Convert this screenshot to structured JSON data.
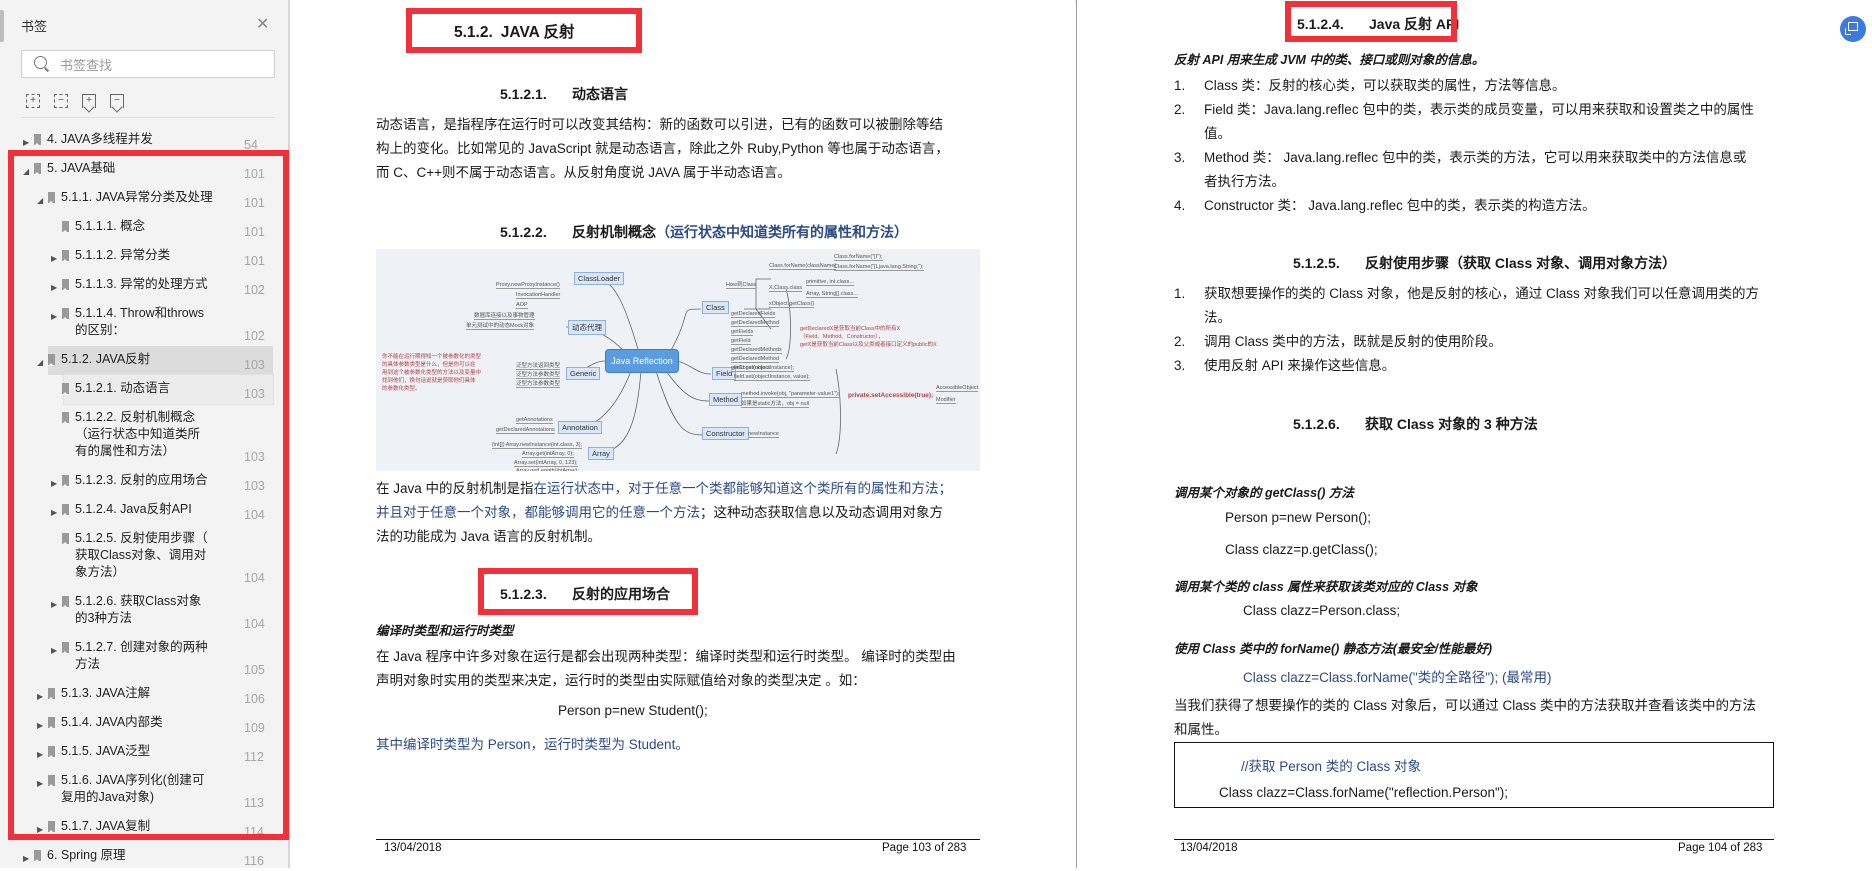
{
  "sidebar": {
    "title": "书签",
    "close_icon": "close-icon",
    "search_placeholder": "书签查找",
    "tools": [
      "expand-all-icon",
      "collapse-all-icon",
      "add-bookmark-icon",
      "remove-bookmark-icon"
    ],
    "items": [
      {
        "label": "4. JAVA多线程并发",
        "page": "54",
        "level": 0,
        "toggle": "collapsed"
      },
      {
        "label": "5. JAVA基础",
        "page": "101",
        "level": 0,
        "toggle": "expanded"
      },
      {
        "label": "5.1.1. JAVA异常分类及处理",
        "page": "101",
        "level": 1,
        "toggle": "expanded"
      },
      {
        "label": "5.1.1.1. 概念",
        "page": "101",
        "level": 2,
        "toggle": "none"
      },
      {
        "label": "5.1.1.2. 异常分类",
        "page": "101",
        "level": 2,
        "toggle": "collapsed"
      },
      {
        "label": "5.1.1.3. 异常的处理方式",
        "page": "102",
        "level": 2,
        "toggle": "collapsed"
      },
      {
        "label": "5.1.1.4. Throw和throws",
        "label2": "的区别：",
        "page": "102",
        "level": 2,
        "toggle": "collapsed"
      },
      {
        "label": "5.1.2. JAVA反射",
        "page": "103",
        "level": 1,
        "toggle": "expanded",
        "selected": true
      },
      {
        "label": "5.1.2.1. 动态语言",
        "page": "103",
        "level": 2,
        "toggle": "none",
        "hover": true
      },
      {
        "label": "5.1.2.2. 反射机制概念",
        "label2": "（运行状态中知道类所",
        "label3": "有的属性和方法）",
        "page": "103",
        "level": 2,
        "toggle": "none"
      },
      {
        "label": "5.1.2.3. 反射的应用场合",
        "page": "103",
        "level": 2,
        "toggle": "collapsed"
      },
      {
        "label": "5.1.2.4. Java反射API",
        "page": "104",
        "level": 2,
        "toggle": "collapsed"
      },
      {
        "label": "5.1.2.5. 反射使用步骤（",
        "label2": "获取Class对象、调用对",
        "label3": "象方法）",
        "page": "104",
        "level": 2,
        "toggle": "none"
      },
      {
        "label": "5.1.2.6. 获取Class对象",
        "label2": "的3种方法",
        "page": "104",
        "level": 2,
        "toggle": "collapsed"
      },
      {
        "label": "5.1.2.7. 创建对象的两种",
        "label2": "方法",
        "page": "105",
        "level": 2,
        "toggle": "collapsed"
      },
      {
        "label": "5.1.3. JAVA注解",
        "page": "106",
        "level": 1,
        "toggle": "collapsed"
      },
      {
        "label": "5.1.4. JAVA内部类",
        "page": "109",
        "level": 1,
        "toggle": "collapsed"
      },
      {
        "label": "5.1.5. JAVA泛型",
        "page": "112",
        "level": 1,
        "toggle": "collapsed"
      },
      {
        "label": "5.1.6. JAVA序列化(创建可",
        "label2": "复用的Java对象)",
        "page": "113",
        "level": 1,
        "toggle": "collapsed"
      },
      {
        "label": "5.1.7. JAVA复制",
        "page": "114",
        "level": 1,
        "toggle": "collapsed"
      },
      {
        "label": "6. Spring 原理",
        "page": "116",
        "level": 0,
        "toggle": "collapsed"
      }
    ]
  },
  "page_left": {
    "h_512": {
      "num": "5.1.2.",
      "title": "JAVA 反射"
    },
    "h_5121": {
      "num": "5.1.2.1.",
      "title": "动态语言"
    },
    "p_dynamic": [
      "动态语言，是指程序在运行时可以改变其结构：新的函数可以引进，已有的函数可以被删除等结",
      "构上的变化。比如常见的 JavaScript 就是动态语言，除此之外 Ruby,Python 等也属于动态语言，",
      "而 C、C++则不属于动态语言。从反射角度说 JAVA 属于半动态语言。"
    ],
    "h_5122": {
      "num": "5.1.2.2.",
      "title": "反射机制概念",
      "paren": "（运行状态中知道类所有的属性和方法）"
    },
    "mindmap": {
      "center": "Java Reflection",
      "nodes": [
        "ClassLoader",
        "动态代理",
        "Generic",
        "Annotation",
        "Array",
        "Class",
        "Field",
        "Method",
        "Constructor"
      ],
      "class_leaves": [
        "How到Class",
        "Class.forName(className)",
        "Class.forName(\"[I\");",
        "Class.forName(\"[Ljava.lang.String;\");",
        "X.Class.class",
        "primitive, int.class...",
        "Array, String[].class...",
        "xObject.getClass()",
        "getDeclaredFields",
        "getDeclaredMethod",
        "getFields",
        "getField",
        "getDeclaredMethods",
        "getDeclaredMethod",
        "getConstructors",
        "..."
      ],
      "class_note": "getDeclaredX是获取当前Class中的所有X\n（Field、Method、Constructor），\ngetX是获取当前Class以及父类或者接口定义的public的X",
      "proxy_leaves": [
        "Proxy.newProxyInstance()",
        "InvocationHandler",
        "AOP",
        "数据库连接以及事物管理",
        "单元测试中的动态Mock对象"
      ],
      "generic_leaves": [
        "泛型方法返回类型",
        "泛型方法参数类型",
        "泛型方法参数类型"
      ],
      "generic_note": "你不能在运行期得知一个被参数化的类型\n的具体参数类型是什么，但是你可以在\n用到这个被参数化类型的方法以及变量中\n找到他们，换句话说就是获取他们具体\n的参数化类型。",
      "annotation_leaves": [
        "getAnnotations",
        "getDeclaredAnnotations"
      ],
      "array_leaves": [
        "(int[]) Array.newInstance(int.class, 3);",
        "Array.get(intArray, 0);",
        "Array.set(intArray, 0, 123);",
        "Array.getLength(intArray);"
      ],
      "field_leaves": [
        "field.get(objectInstance);",
        "field.set(objectInstance, value);"
      ],
      "method_leaves": [
        "method.invoke(obj, \"parameter-value1\");",
        "如果是static方法，obj = null"
      ],
      "constructor_leaves": [
        "newInstance"
      ],
      "accessible": "private.setAccessible(true);",
      "accessible_leaves": [
        "AccessibleObject",
        "Modifier"
      ]
    },
    "p_mechanism": {
      "a": "在 Java 中的反射机制是指",
      "b": "在运行状态中，对于任意一个类都能够知道这个类所有的属性和方法；",
      "c": "并且对于任意一个对象，都能够调用它的任意一个方法",
      "d": "；这种动态获取信息以及动态调用对象方",
      "e": "法的功能成为 Java 语言的反射机制。"
    },
    "h_5123": {
      "num": "5.1.2.3.",
      "title": "反射的应用场合"
    },
    "bi_types": "编译时类型和运行时类型",
    "p_types": [
      "在 Java 程序中许多对象在运行是都会出现两种类型：编译时类型和运行时类型。 编译时的类型由",
      "声明对象时实用的类型来决定，运行时的类型由实际赋值给对象的类型决定 。如："
    ],
    "code_student": "Person p=new Student();",
    "p_types_blue": "其中编译时类型为 Person，运行时类型为 Student。",
    "footer_date": "13/04/2018",
    "footer_page": "Page 103 of 283"
  },
  "page_right": {
    "h_5124": {
      "num": "5.1.2.4.",
      "title": "Java 反射 API"
    },
    "bi_api": "反射 API 用来生成 JVM 中的类、接口或则对象的信息。",
    "api_list": [
      {
        "n": "1.",
        "lines": [
          "Class 类：反射的核心类，可以获取类的属性，方法等信息。"
        ]
      },
      {
        "n": "2.",
        "lines": [
          "Field 类：Java.lang.reflec 包中的类，表示类的成员变量，可以用来获取和设置类之中的属性",
          "值。"
        ]
      },
      {
        "n": "3.",
        "lines": [
          "Method 类： Java.lang.reflec 包中的类，表示类的方法，它可以用来获取类中的方法信息或",
          "者执行方法。"
        ]
      },
      {
        "n": "4.",
        "lines": [
          "Constructor 类： Java.lang.reflec 包中的类，表示类的构造方法。"
        ]
      }
    ],
    "h_5125": {
      "num": "5.1.2.5.",
      "title": "反射使用步骤（获取 Class 对象、调用对象方法）"
    },
    "steps_list": [
      {
        "n": "1.",
        "lines": [
          "获取想要操作的类的 Class 对象，他是反射的核心，通过 Class 对象我们可以任意调用类的方",
          "法。"
        ]
      },
      {
        "n": "2.",
        "lines": [
          "调用 Class 类中的方法，既就是反射的使用阶段。"
        ]
      },
      {
        "n": "3.",
        "lines": [
          "使用反射 API 来操作这些信息。"
        ]
      }
    ],
    "h_5126": {
      "num": "5.1.2.6.",
      "title": "获取 Class 对象的 3 种方法"
    },
    "bi_getclass": "调用某个对象的 getClass() 方法",
    "code_1": "Person p=new Person();",
    "code_2": "Class clazz=p.getClass();",
    "bi_classattr": "调用某个类的 class 属性来获取该类对应的 Class 对象",
    "code_3": "Class clazz=Person.class;",
    "bi_forname": "使用 Class 类中的 forName() 静态方法(最安全/性能最好)",
    "code_4": "Class clazz=Class.forName(\"类的全路径\"); (最常用)",
    "p_after": [
      "当我们获得了想要操作的类的 Class 对象后，可以通过 Class 类中的方法获取并查看该类中的方法",
      "和属性。"
    ],
    "codebox_comment": "//获取 Person 类的 Class 对象",
    "codebox_code": "Class clazz=Class.forName(\"reflection.Person\");",
    "footer_date": "13/04/2018",
    "footer_page": "Page 104 of 283"
  },
  "floating_button": "translate-icon",
  "colors": {
    "highlight_red": "#f0303a",
    "link_blue": "#2c4a86",
    "fab_blue": "#3b7be0"
  }
}
